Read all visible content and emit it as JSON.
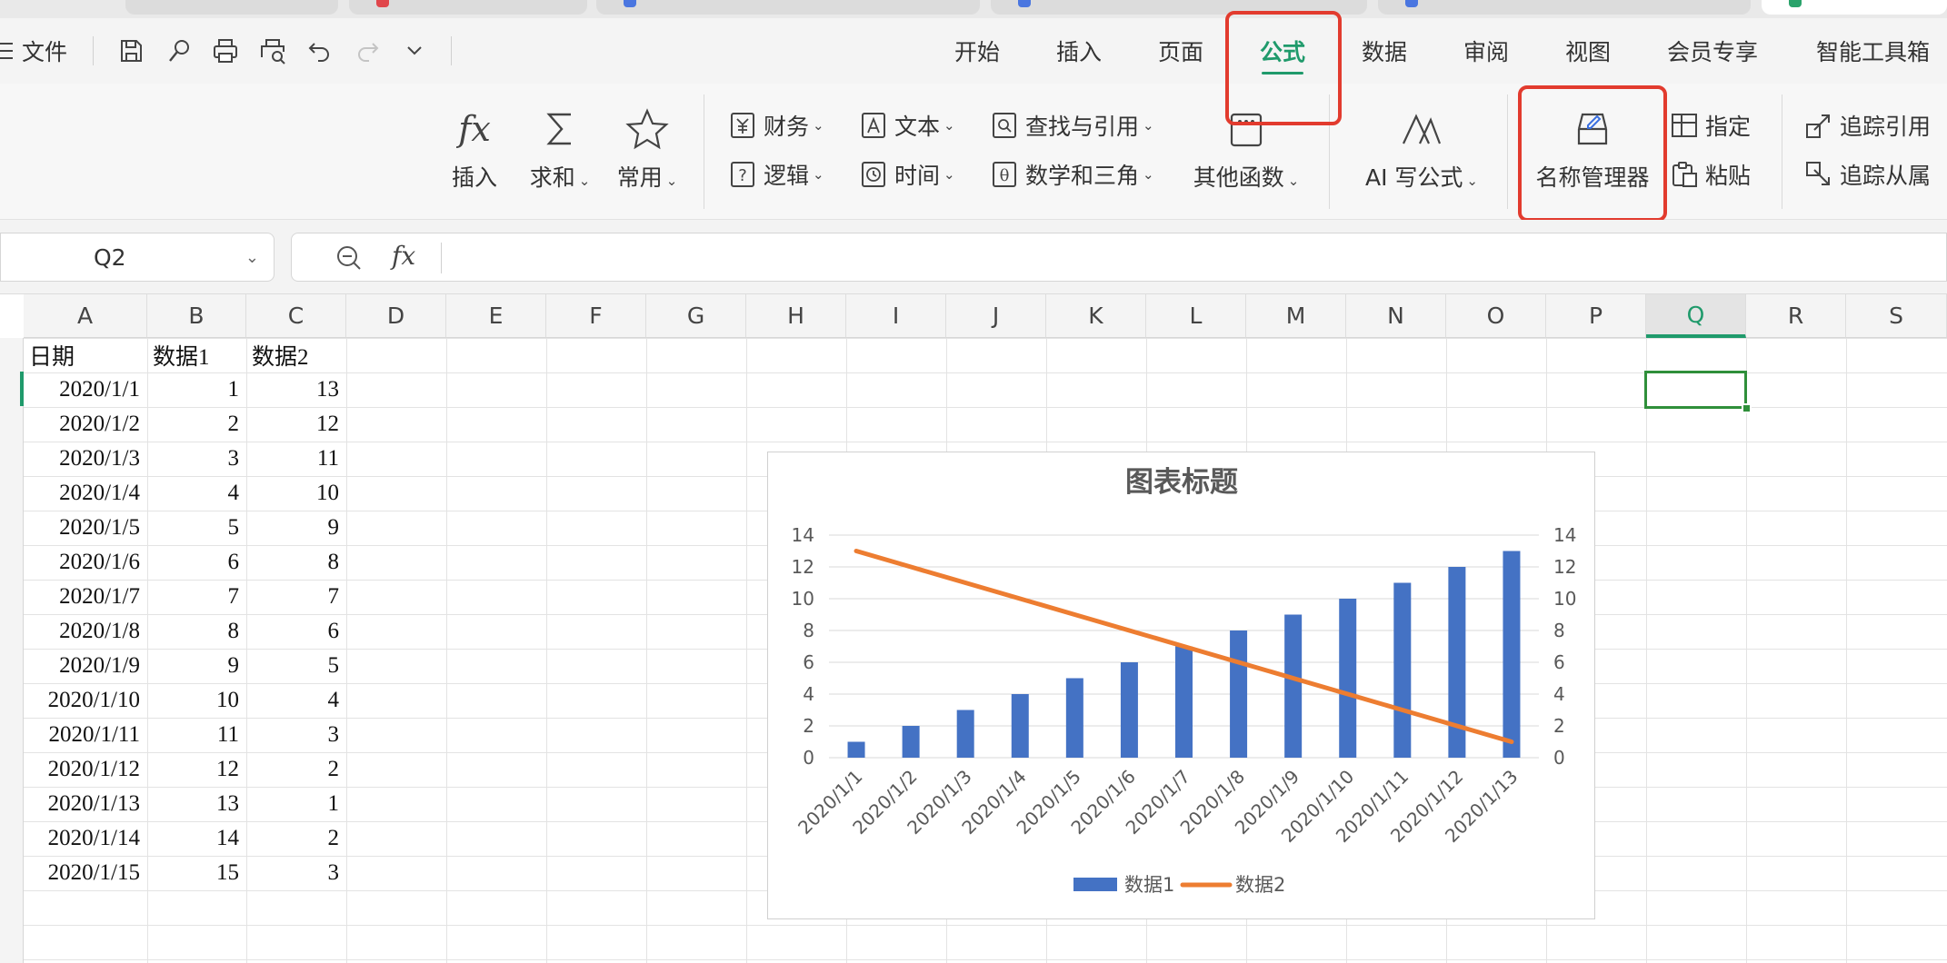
{
  "app": {
    "accent": "#1f9a6b",
    "highlight": "#e23b2e"
  },
  "menubar": {
    "file_label": "文件",
    "quick_access": [
      "save-icon",
      "format-painter-icon",
      "print-icon",
      "print-preview-icon",
      "undo-icon",
      "redo-icon",
      "more-dropdown-icon"
    ],
    "tabs": [
      "开始",
      "插入",
      "页面",
      "公式",
      "数据",
      "审阅",
      "视图",
      "会员专享",
      "智能工具箱"
    ],
    "active_tab": "公式"
  },
  "ribbon": {
    "insert_fn": "插入",
    "autosum": "求和",
    "common": "常用",
    "finance": "财务",
    "text": "文本",
    "lookup": "查找与引用",
    "logic": "逻辑",
    "time": "时间",
    "math": "数学和三角",
    "other_fn": "其他函数",
    "ai_formula": "AI 写公式",
    "name_manager": "名称管理器",
    "define": "指定",
    "paste": "粘贴",
    "trace_precedents": "追踪引用",
    "trace_dependents": "追踪从属"
  },
  "formula_bar": {
    "cell_ref": "Q2",
    "fx_label": "fx",
    "formula": ""
  },
  "sheet": {
    "columns": [
      "A",
      "B",
      "C",
      "D",
      "E",
      "F",
      "G",
      "H",
      "I",
      "J",
      "K",
      "L",
      "M",
      "N",
      "O",
      "P",
      "Q",
      "R",
      "S"
    ],
    "selected_column": "Q",
    "selected_cell": "Q2",
    "header_row": [
      "日期",
      "数据1",
      "数据2"
    ],
    "rows": [
      [
        "2020/1/1",
        "1",
        "13"
      ],
      [
        "2020/1/2",
        "2",
        "12"
      ],
      [
        "2020/1/3",
        "3",
        "11"
      ],
      [
        "2020/1/4",
        "4",
        "10"
      ],
      [
        "2020/1/5",
        "5",
        "9"
      ],
      [
        "2020/1/6",
        "6",
        "8"
      ],
      [
        "2020/1/7",
        "7",
        "7"
      ],
      [
        "2020/1/8",
        "8",
        "6"
      ],
      [
        "2020/1/9",
        "9",
        "5"
      ],
      [
        "2020/1/10",
        "10",
        "4"
      ],
      [
        "2020/1/11",
        "11",
        "3"
      ],
      [
        "2020/1/12",
        "12",
        "2"
      ],
      [
        "2020/1/13",
        "13",
        "1"
      ],
      [
        "2020/1/14",
        "14",
        "2"
      ],
      [
        "2020/1/15",
        "15",
        "3"
      ]
    ]
  },
  "chart_data": {
    "type": "bar",
    "title": "图表标题",
    "categories": [
      "2020/1/1",
      "2020/1/2",
      "2020/1/3",
      "2020/1/4",
      "2020/1/5",
      "2020/1/6",
      "2020/1/7",
      "2020/1/8",
      "2020/1/9",
      "2020/1/10",
      "2020/1/11",
      "2020/1/12",
      "2020/1/13"
    ],
    "series": [
      {
        "name": "数据1",
        "type": "bar",
        "color": "#4472c4",
        "values": [
          1,
          2,
          3,
          4,
          5,
          6,
          7,
          8,
          9,
          10,
          11,
          12,
          13
        ]
      },
      {
        "name": "数据2",
        "type": "line",
        "color": "#ed7d31",
        "axis": "secondary",
        "values": [
          13,
          12,
          11,
          10,
          9,
          8,
          7,
          6,
          5,
          4,
          3,
          2,
          1
        ]
      }
    ],
    "ylim": [
      0,
      14
    ],
    "y2lim": [
      0,
      14
    ],
    "yticks": [
      "0",
      "2",
      "4",
      "6",
      "8",
      "10",
      "12",
      "14"
    ],
    "grid": true,
    "legend": "bottom"
  }
}
